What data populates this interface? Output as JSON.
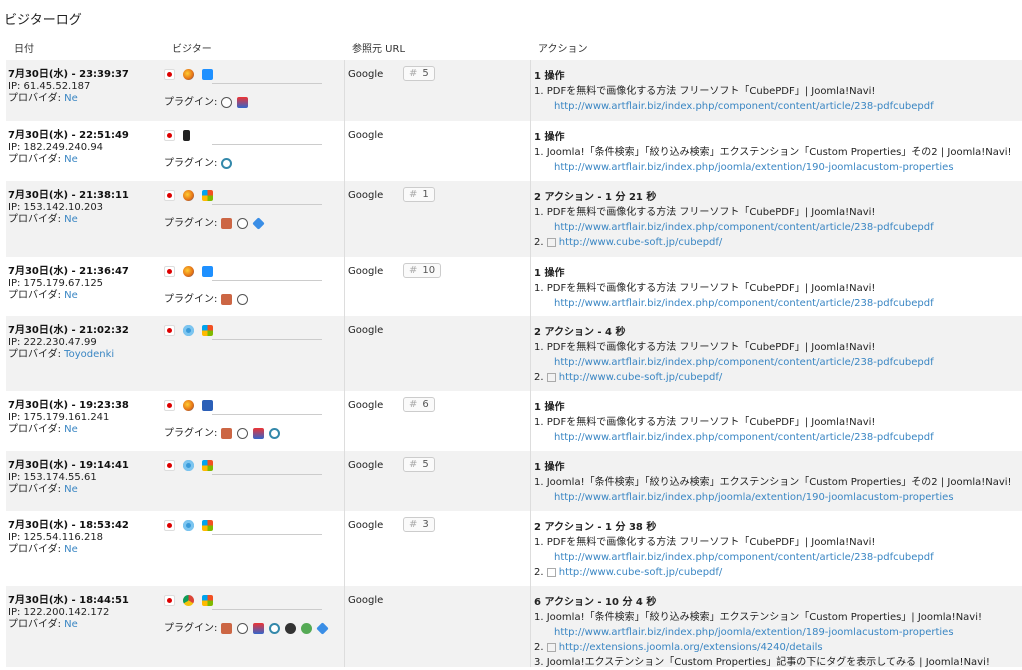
{
  "title": "ビジターログ",
  "columns": {
    "date": "日付",
    "visitor": "ビジター",
    "referrer": "参照元 URL",
    "action": "アクション"
  },
  "labels": {
    "plugins": "プラグイン:"
  },
  "rows": [
    {
      "datetime": "7月30日(水) - 23:39:37",
      "ip": "IP: 61.45.52.187",
      "provider_label": "プロバイダ:",
      "provider": "Ne",
      "browser_icons": [
        "japan-flag-icon",
        "firefox-icon",
        "windows-icon"
      ],
      "plugin_icons": [
        "quicktime-icon",
        "java-icon"
      ],
      "referrer": "Google",
      "rank": "5",
      "action_header": "1 操作",
      "actions": [
        {
          "num": "1.",
          "title": "PDFを無料で画像化する方法 フリーソフト「CubePDF」| Joomla!Navi!",
          "url": "http://www.artflair.biz/index.php/component/content/article/238-pdfcubepdf"
        }
      ]
    },
    {
      "datetime": "7月30日(水) - 22:51:49",
      "ip": "IP: 182.249.240.94",
      "provider_label": "プロバイダ:",
      "provider": "Ne",
      "browser_icons": [
        "japan-flag-icon",
        "mobile-icon"
      ],
      "plugin_icons": [
        "quicktime-alt-icon"
      ],
      "referrer": "Google",
      "rank": "",
      "action_header": "1 操作",
      "actions": [
        {
          "num": "1.",
          "title": "Joomla!「条件検索」「絞り込み検索」エクステンション「Custom Properties」その2 | Joomla!Navi!",
          "url": "http://www.artflair.biz/index.php/joomla/extention/190-joomlacustom-properties"
        }
      ]
    },
    {
      "datetime": "7月30日(水) - 21:38:11",
      "ip": "IP: 153.142.10.203",
      "provider_label": "プロバイダ:",
      "provider": "Ne",
      "browser_icons": [
        "japan-flag-icon",
        "firefox-icon",
        "windows-xp-icon"
      ],
      "plugin_icons": [
        "acrobat-icon",
        "quicktime-icon",
        "silverlight-icon"
      ],
      "referrer": "Google",
      "rank": "1",
      "action_header": "2 アクション - 1 分 21 秒",
      "actions": [
        {
          "num": "1.",
          "title": "PDFを無料で画像化する方法 フリーソフト「CubePDF」| Joomla!Navi!",
          "url": "http://www.artflair.biz/index.php/component/content/article/238-pdfcubepdf"
        },
        {
          "num": "2.",
          "external": "http://www.cube-soft.jp/cubepdf/"
        }
      ]
    },
    {
      "datetime": "7月30日(水) - 21:36:47",
      "ip": "IP: 175.179.67.125",
      "provider_label": "プロバイダ:",
      "provider": "Ne",
      "browser_icons": [
        "japan-flag-icon",
        "firefox-icon",
        "windows-icon"
      ],
      "plugin_icons": [
        "acrobat-icon",
        "quicktime-icon"
      ],
      "referrer": "Google",
      "rank": "10",
      "action_header": "1 操作",
      "actions": [
        {
          "num": "1.",
          "title": "PDFを無料で画像化する方法 フリーソフト「CubePDF」| Joomla!Navi!",
          "url": "http://www.artflair.biz/index.php/component/content/article/238-pdfcubepdf"
        }
      ]
    },
    {
      "datetime": "7月30日(水) - 21:02:32",
      "ip": "IP: 222.230.47.99",
      "provider_label": "プロバイダ:",
      "provider": "Toyodenki",
      "browser_icons": [
        "japan-flag-icon",
        "ie-icon",
        "windows-xp-icon"
      ],
      "plugin_icons": [],
      "referrer": "Google",
      "rank": "",
      "action_header": "2 アクション - 4 秒",
      "actions": [
        {
          "num": "1.",
          "title": "PDFを無料で画像化する方法 フリーソフト「CubePDF」| Joomla!Navi!",
          "url": "http://www.artflair.biz/index.php/component/content/article/238-pdfcubepdf"
        },
        {
          "num": "2.",
          "external": "http://www.cube-soft.jp/cubepdf/"
        }
      ]
    },
    {
      "datetime": "7月30日(水) - 19:23:38",
      "ip": "IP: 175.179.161.241",
      "provider_label": "プロバイダ:",
      "provider": "Ne",
      "browser_icons": [
        "japan-flag-icon",
        "firefox-icon",
        "mac-icon"
      ],
      "plugin_icons": [
        "acrobat-icon",
        "quicktime-icon",
        "java-icon",
        "quicktime-alt-icon"
      ],
      "referrer": "Google",
      "rank": "6",
      "action_header": "1 操作",
      "actions": [
        {
          "num": "1.",
          "title": "PDFを無料で画像化する方法 フリーソフト「CubePDF」| Joomla!Navi!",
          "url": "http://www.artflair.biz/index.php/component/content/article/238-pdfcubepdf"
        }
      ]
    },
    {
      "datetime": "7月30日(水) - 19:14:41",
      "ip": "IP: 153.174.55.61",
      "provider_label": "プロバイダ:",
      "provider": "Ne",
      "browser_icons": [
        "japan-flag-icon",
        "ie-icon",
        "windows-xp-icon"
      ],
      "plugin_icons": [],
      "referrer": "Google",
      "rank": "5",
      "action_header": "1 操作",
      "actions": [
        {
          "num": "1.",
          "title": "Joomla!「条件検索」「絞り込み検索」エクステンション「Custom Properties」その2 | Joomla!Navi!",
          "url": "http://www.artflair.biz/index.php/joomla/extention/190-joomlacustom-properties"
        }
      ]
    },
    {
      "datetime": "7月30日(水) - 18:53:42",
      "ip": "IP: 125.54.116.218",
      "provider_label": "プロバイダ:",
      "provider": "Ne",
      "browser_icons": [
        "japan-flag-icon",
        "ie-icon",
        "windows-xp-icon"
      ],
      "plugin_icons": [],
      "referrer": "Google",
      "rank": "3",
      "action_header": "2 アクション - 1 分 38 秒",
      "actions": [
        {
          "num": "1.",
          "title": "PDFを無料で画像化する方法 フリーソフト「CubePDF」| Joomla!Navi!",
          "url": "http://www.artflair.biz/index.php/component/content/article/238-pdfcubepdf"
        },
        {
          "num": "2.",
          "external": "http://www.cube-soft.jp/cubepdf/"
        }
      ]
    },
    {
      "datetime": "7月30日(水) - 18:44:51",
      "ip": "IP: 122.200.142.172",
      "provider_label": "プロバイダ:",
      "provider": "Ne",
      "browser_icons": [
        "japan-flag-icon",
        "chrome-icon",
        "windows-xp-icon"
      ],
      "plugin_icons": [
        "acrobat-icon",
        "quicktime-icon",
        "java-icon",
        "quicktime-alt-icon",
        "flash-icon",
        "chrome-plugin-icon",
        "silverlight-icon"
      ],
      "referrer": "Google",
      "rank": "",
      "action_header": "6 アクション - 10 分 4 秒",
      "actions": [
        {
          "num": "1.",
          "title": "Joomla!「条件検索」「絞り込み検索」エクステンション「Custom Properties」| Joomla!Navi!",
          "url": "http://www.artflair.biz/index.php/joomla/extention/189-joomlacustom-properties"
        },
        {
          "num": "2.",
          "external": "http://extensions.joomla.org/extensions/4240/details"
        },
        {
          "num": "3.",
          "title": "Joomla!エクステンション「Custom Properties」記事の下にタグを表示してみる | Joomla!Navi!"
        }
      ]
    }
  ]
}
